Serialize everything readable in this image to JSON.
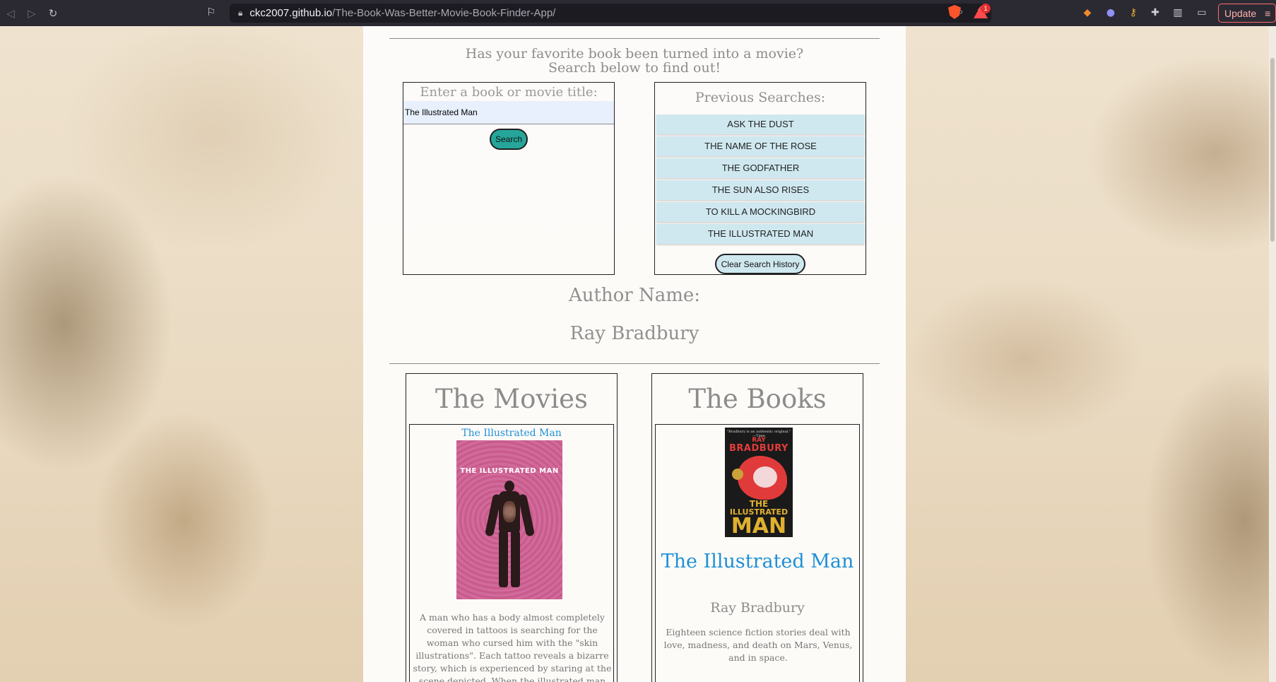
{
  "browser": {
    "url_host": "ckc2007.github.io",
    "url_path": "/The-Book-Was-Better-Movie-Book-Finder-App/",
    "bat_badge_count": "1",
    "update_label": "Update",
    "back_icon": "back-arrow-icon",
    "forward_icon": "forward-arrow-icon",
    "reload_icon": "reload-icon"
  },
  "intro": {
    "line1": "Has your favorite book been turned into a movie?",
    "line2": "Search below to find out!"
  },
  "search": {
    "label": "Enter a book or movie title:",
    "value": "The Illustrated Man",
    "button": "Search"
  },
  "history": {
    "title": "Previous Searches:",
    "items": [
      "ASK THE DUST",
      "THE NAME OF THE ROSE",
      "THE GODFATHER",
      "THE SUN ALSO RISES",
      "TO KILL A MOCKINGBIRD",
      "THE ILLUSTRATED MAN"
    ],
    "clear_button": "Clear Search History"
  },
  "author": {
    "heading": "Author Name:",
    "name": "Ray Bradbury"
  },
  "movies": {
    "title": "The Movies",
    "movie_title": "The Illustrated Man",
    "poster_text": "THE ILLUSTRATED MAN",
    "description": "A man who has a body almost completely covered in tattoos is searching for the woman who cursed him with the \"skin illustrations\". Each tattoo reveals a bizarre story, which is experienced by staring at the scene depicted. When the illustrated man meets a fellow"
  },
  "books": {
    "title": "The Books",
    "book_title": "The Illustrated Man",
    "author": "Ray Bradbury",
    "description": "Eighteen science fiction stories deal with love, madness, and death on Mars, Venus, and in space.",
    "cover": {
      "quote": "\"Bradbury is an authentic original.\" —Time",
      "ray": "RAY",
      "bradbury": "BRADBURY",
      "the": "THE",
      "illustrated": "ILLUSTRATED",
      "man": "MAN"
    }
  }
}
